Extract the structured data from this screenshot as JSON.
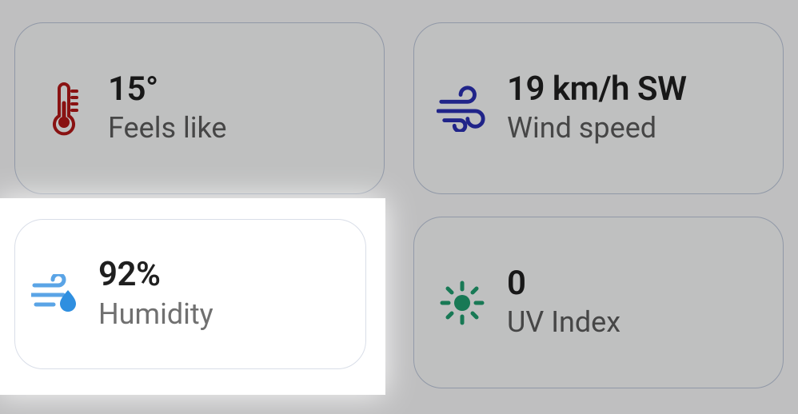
{
  "tiles": {
    "feels_like": {
      "value": "15°",
      "label": "Feels like"
    },
    "wind": {
      "value": "19 km/h SW",
      "label": "Wind speed"
    },
    "humidity": {
      "value": "92%",
      "label": "Humidity"
    },
    "uv": {
      "value": "0",
      "label": "UV Index"
    }
  },
  "colors": {
    "thermometer": "#b01818",
    "wind": "#2a2fb0",
    "humidity": "#5aa4e6",
    "uv": "#1f9c6e"
  }
}
